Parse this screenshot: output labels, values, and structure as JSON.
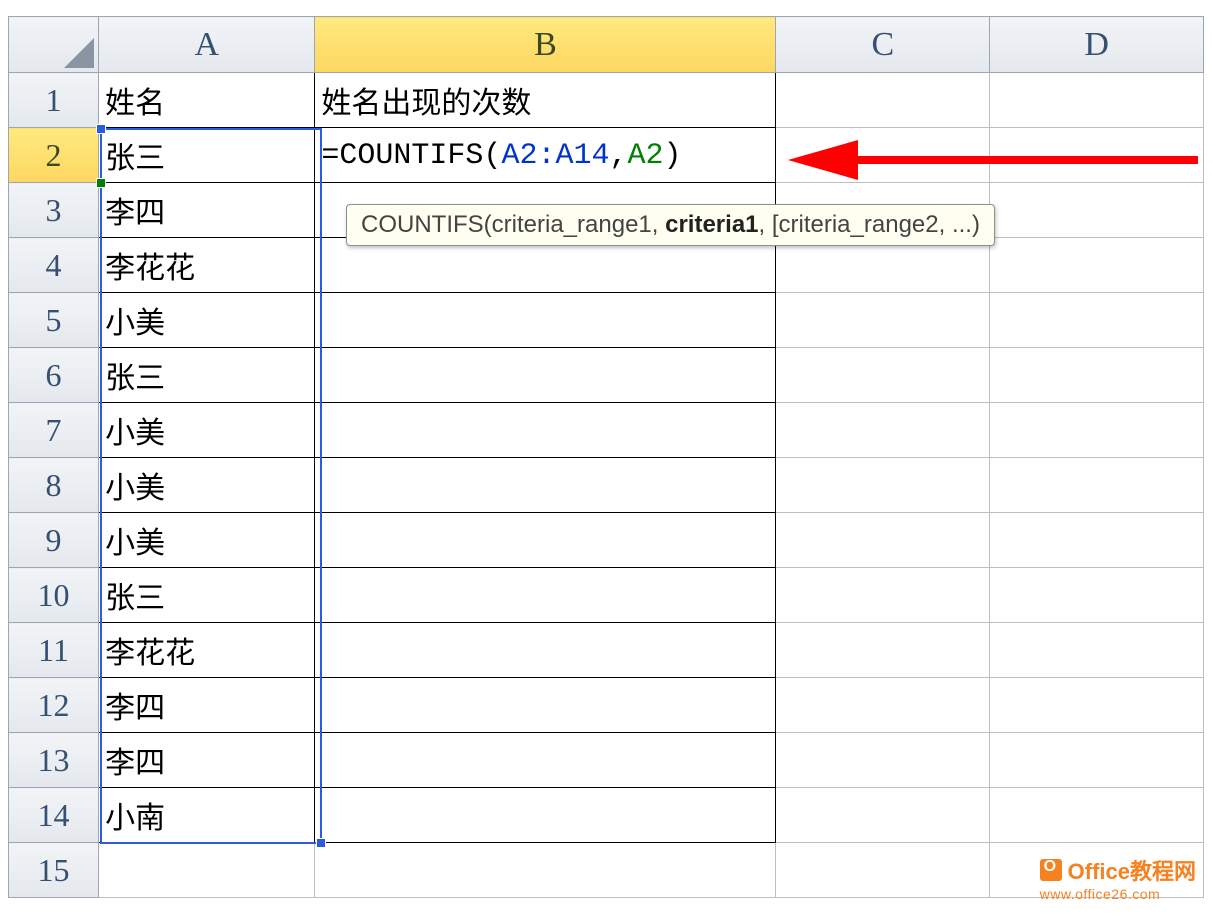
{
  "columns": [
    "A",
    "B",
    "C",
    "D"
  ],
  "rows": [
    "1",
    "2",
    "3",
    "4",
    "5",
    "6",
    "7",
    "8",
    "9",
    "10",
    "11",
    "12",
    "13",
    "14",
    "15"
  ],
  "activeColumn": "B",
  "activeRow": "2",
  "headers": {
    "A1": "姓名",
    "B1": "姓名出现的次数"
  },
  "cellsA": [
    "张三",
    "李四",
    "李花花",
    "小美",
    "张三",
    "小美",
    "小美",
    "小美",
    "张三",
    "李花花",
    "李四",
    "李四",
    "小南"
  ],
  "formula": {
    "prefix": "=",
    "fn": "COUNTIFS",
    "open": "(",
    "ref1": "A2:A14",
    "comma": ",",
    "ref2": "A2",
    "close": ")"
  },
  "tooltip": {
    "fn": "COUNTIFS",
    "open": "(",
    "arg1": "criteria_range1",
    "sep": ", ",
    "arg2": "criteria1",
    "rest": ", [criteria_range2, ...)"
  },
  "watermark": {
    "title": "Office教程网",
    "url": "www.office26.com"
  }
}
